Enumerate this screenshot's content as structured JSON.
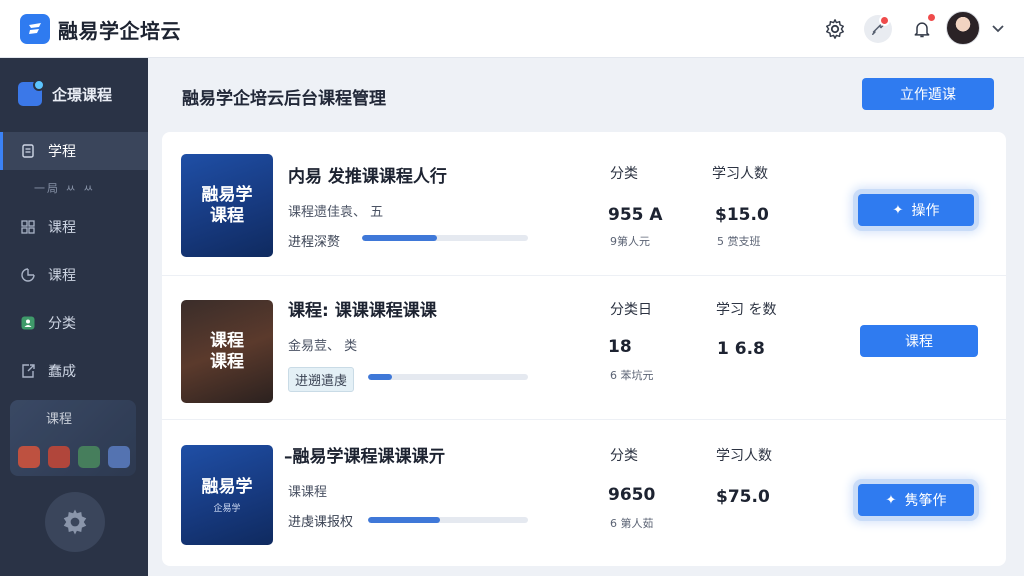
{
  "header": {
    "brand": "融易学企培云",
    "icons": [
      "settings-icon",
      "tools-icon",
      "notification-icon"
    ],
    "accent": "#2f7bf0"
  },
  "sidebar": {
    "title": "企璟课程",
    "sub_text": "一局 ㅆ ㅆ",
    "items": [
      {
        "label": "学程",
        "icon": "document-icon",
        "active": true
      },
      {
        "label": "课程",
        "icon": "grid-icon",
        "active": false
      },
      {
        "label": "课程",
        "icon": "chart-icon",
        "active": false
      },
      {
        "label": "分类",
        "icon": "category-icon",
        "active": false
      },
      {
        "label": "蠢成",
        "icon": "export-icon",
        "active": false
      }
    ],
    "thumb_label": "课程"
  },
  "main": {
    "page_title": "融易学企培云后台课程管理",
    "primary_button": "立作遁谋"
  },
  "courses": [
    {
      "thumb_line1": "融易学",
      "thumb_line2": "课程",
      "title": "内易  发推课课程人行",
      "sub": "课程遗佳袁、 五",
      "progress_label": "进程深赘",
      "progress": 0.45,
      "col1_header": "分类",
      "col1_value": "955 A",
      "col1_sub": "9第人元",
      "col2_header": "学习人数",
      "col2_value": "$15.0",
      "col2_sub": "5 赏支班",
      "button": "操作"
    },
    {
      "thumb_line1": "课程",
      "thumb_line2": "课程",
      "title": "课程: 课课课程课课",
      "sub": "金易荳、 类",
      "progress_label": "进遡遣虔",
      "progress": 0.15,
      "col1_header": "分类日",
      "col1_value": "18",
      "col1_sub": "6 苯坑元",
      "col2_header": "学习 を数",
      "col2_value": "1  6.8",
      "col2_sub": "",
      "button": "课程"
    },
    {
      "thumb_line1": "融易学",
      "thumb_line2": "企易学",
      "title": "–融易学课程课课课亓",
      "sub": "课课程",
      "progress_label": "进虔课报权",
      "progress": 0.45,
      "col1_header": "分类",
      "col1_value": "9650",
      "col1_sub": "6 第人茹",
      "col2_header": "学习人数",
      "col2_value": "$75.0",
      "col2_sub": "",
      "button": "隽筝作"
    }
  ]
}
